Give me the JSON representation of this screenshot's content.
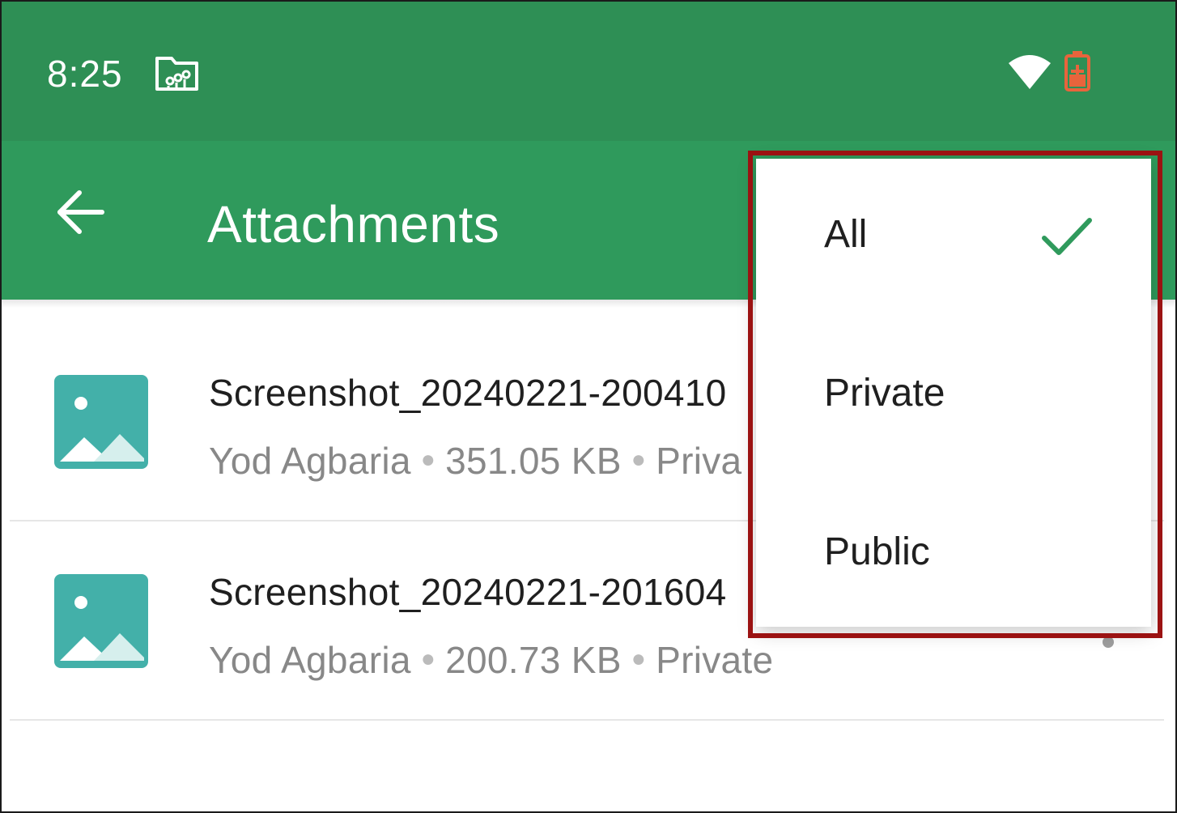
{
  "status_bar": {
    "time": "8:25",
    "app_icon": "folder-chart-icon",
    "wifi_icon": "wifi-icon",
    "battery_icon": "battery-charging-icon",
    "battery_color": "#e8643c"
  },
  "app_bar": {
    "back_icon": "arrow-back-icon",
    "title": "Attachments",
    "color": "#2f9a5c"
  },
  "attachments": [
    {
      "name": "Screenshot_20240221-200410",
      "author": "Yod Agbaria",
      "size": "351.05 KB",
      "visibility": "Priva",
      "icon": "image-file-icon"
    },
    {
      "name": "Screenshot_20240221-201604",
      "author": "Yod Agbaria",
      "size": "200.73 KB",
      "visibility": "Private",
      "icon": "image-file-icon"
    }
  ],
  "filter_menu": {
    "items": [
      {
        "label": "All",
        "selected": true
      },
      {
        "label": "Private",
        "selected": false
      },
      {
        "label": "Public",
        "selected": false
      }
    ],
    "check_icon": "checkmark-icon",
    "highlight_color": "#9b1212",
    "accent_color": "#2f9a5c"
  }
}
